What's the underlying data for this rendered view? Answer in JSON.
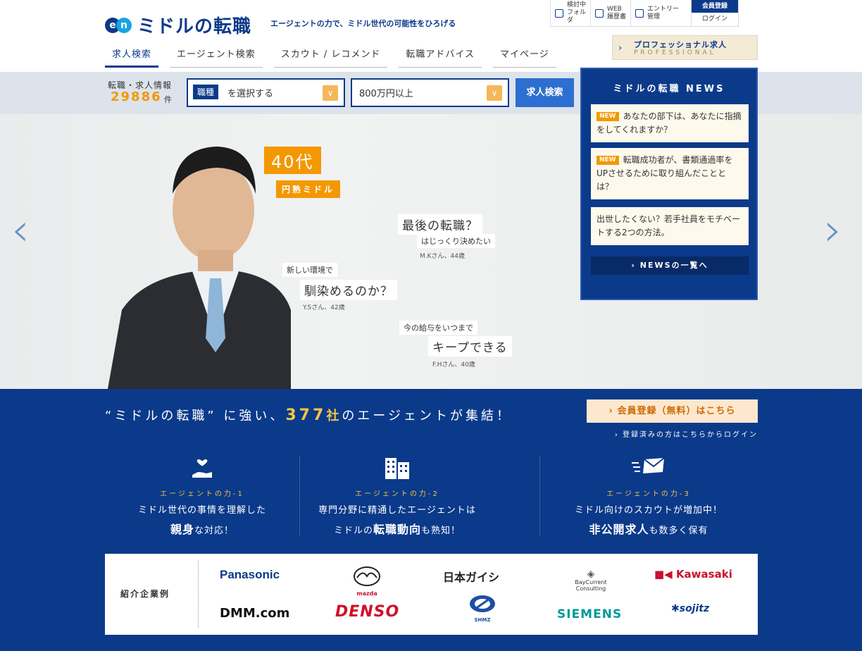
{
  "header": {
    "logo_text": "ミドルの転職",
    "logo_en": "en",
    "tagline": "エージェントの力で、ミドル世代の可能性をひろげる",
    "util": [
      {
        "icon": "folder-icon",
        "label": "検討中\nフォルダ"
      },
      {
        "icon": "resume-icon",
        "label": "WEB\n履歴書"
      },
      {
        "icon": "entry-icon",
        "label": "エントリー\n管理"
      }
    ],
    "register": "会員登録",
    "login": "ログイン",
    "nav": [
      "求人検索",
      "エージェント検索",
      "スカウト / レコメンド",
      "転職アドバイス",
      "マイページ"
    ],
    "pro_title": "プロフェッショナル求人",
    "pro_sub": "PROFESSIONAL"
  },
  "search": {
    "count_label": "転職・求人情報",
    "count": "29886",
    "count_unit": "件",
    "job_tag": "職種",
    "job_placeholder": "を選択する",
    "salary": "800万円以上",
    "button": "求人検索"
  },
  "hero": {
    "age": "40代",
    "age_sub": "円熟ミドル",
    "quotes": [
      {
        "big": "最後の転職？",
        "small": "はじっくり決めたい",
        "name": "M.Kさん、44歳"
      },
      {
        "small": "新しい環境で",
        "big": "馴染めるのか？",
        "name": "Y.Sさん、42歳"
      },
      {
        "small": "今の給与をいつまで",
        "big": "キープできる",
        "name": "F.Hさん、40歳"
      }
    ]
  },
  "news": {
    "title": "ミドルの転職 NEWS",
    "new_tag": "NEW",
    "items": [
      {
        "new": true,
        "text": "あなたの部下は、あなたに指摘をしてくれますか？"
      },
      {
        "new": true,
        "text": "転職成功者が、書類通過率をUPさせるために取り組んだこととは？"
      },
      {
        "new": false,
        "text": "出世したくない？若手社員をモチベートする2つの方法。"
      }
    ],
    "more": "NEWSの一覧へ"
  },
  "agent": {
    "headline_pre": "“ミドルの転職” に強い、",
    "headline_num": "377",
    "headline_sha": "社",
    "headline_post": "のエージェントが集結！",
    "register_btn": "会員登録（無料）はこちら",
    "login_link": "登録済みの方はこちらからログイン",
    "points": [
      {
        "icon": "heart-hand-icon",
        "label": "エージェントの力-1",
        "l1": "ミドル世代の事情を理解した",
        "l2b": "親身",
        "l2": "な対応！"
      },
      {
        "icon": "building-icon",
        "label": "エージェントの力-2",
        "l1": "専門分野に精通したエージェントは",
        "l2p": "ミドルの",
        "l2b": "転職動向",
        "l2": "も熟知！"
      },
      {
        "icon": "mail-icon",
        "label": "エージェントの力-3",
        "l1": "ミドル向けのスカウトが増加中！",
        "l2b": "非公開求人",
        "l2": "も数多く保有"
      }
    ]
  },
  "companies": {
    "label": "紹介企業例",
    "names": [
      "Panasonic",
      "mazda",
      "日本ガイシ",
      "BayCurrent Consulting",
      "Kawasaki",
      "DMM.com",
      "DENSO",
      "SHMZ",
      "SIEMENS",
      "sojitz"
    ]
  },
  "colors": {
    "navy": "#0b3a8a",
    "orange": "#f39800",
    "gold": "#f5c542"
  }
}
